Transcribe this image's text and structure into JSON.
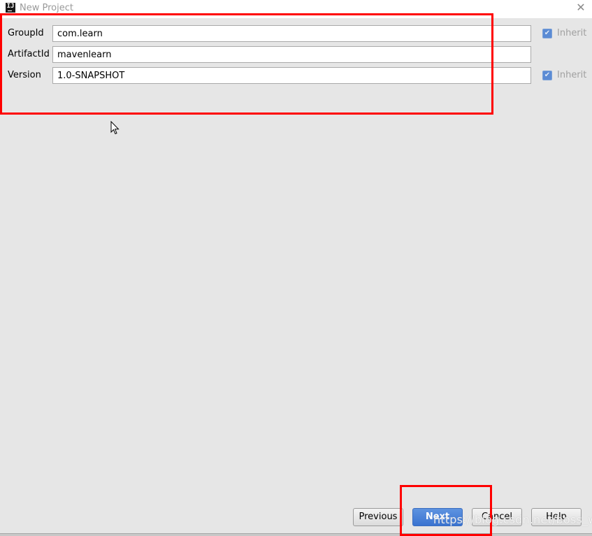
{
  "window": {
    "title": "New Project",
    "app_icon": "intellij-icon",
    "close_icon": "close-icon"
  },
  "form": {
    "fields": [
      {
        "label": "GroupId",
        "value": "com.learn",
        "inherit": true,
        "inherit_label": "Inherit"
      },
      {
        "label": "ArtifactId",
        "value": "mavenlearn",
        "inherit": false
      },
      {
        "label": "Version",
        "value": "1.0-SNAPSHOT",
        "inherit": true,
        "inherit_label": "Inherit"
      }
    ]
  },
  "buttons": {
    "previous": "Previous",
    "next": "Next",
    "cancel": "Cancel",
    "help": "Help"
  },
  "annotations": {
    "highlight_color": "#ff0000",
    "watermark": "https://blog.csdn.net/boss_way"
  },
  "colors": {
    "primary_button": "#3a73d0",
    "checkbox": "#5b8bd4",
    "background": "#e6e6e6"
  }
}
